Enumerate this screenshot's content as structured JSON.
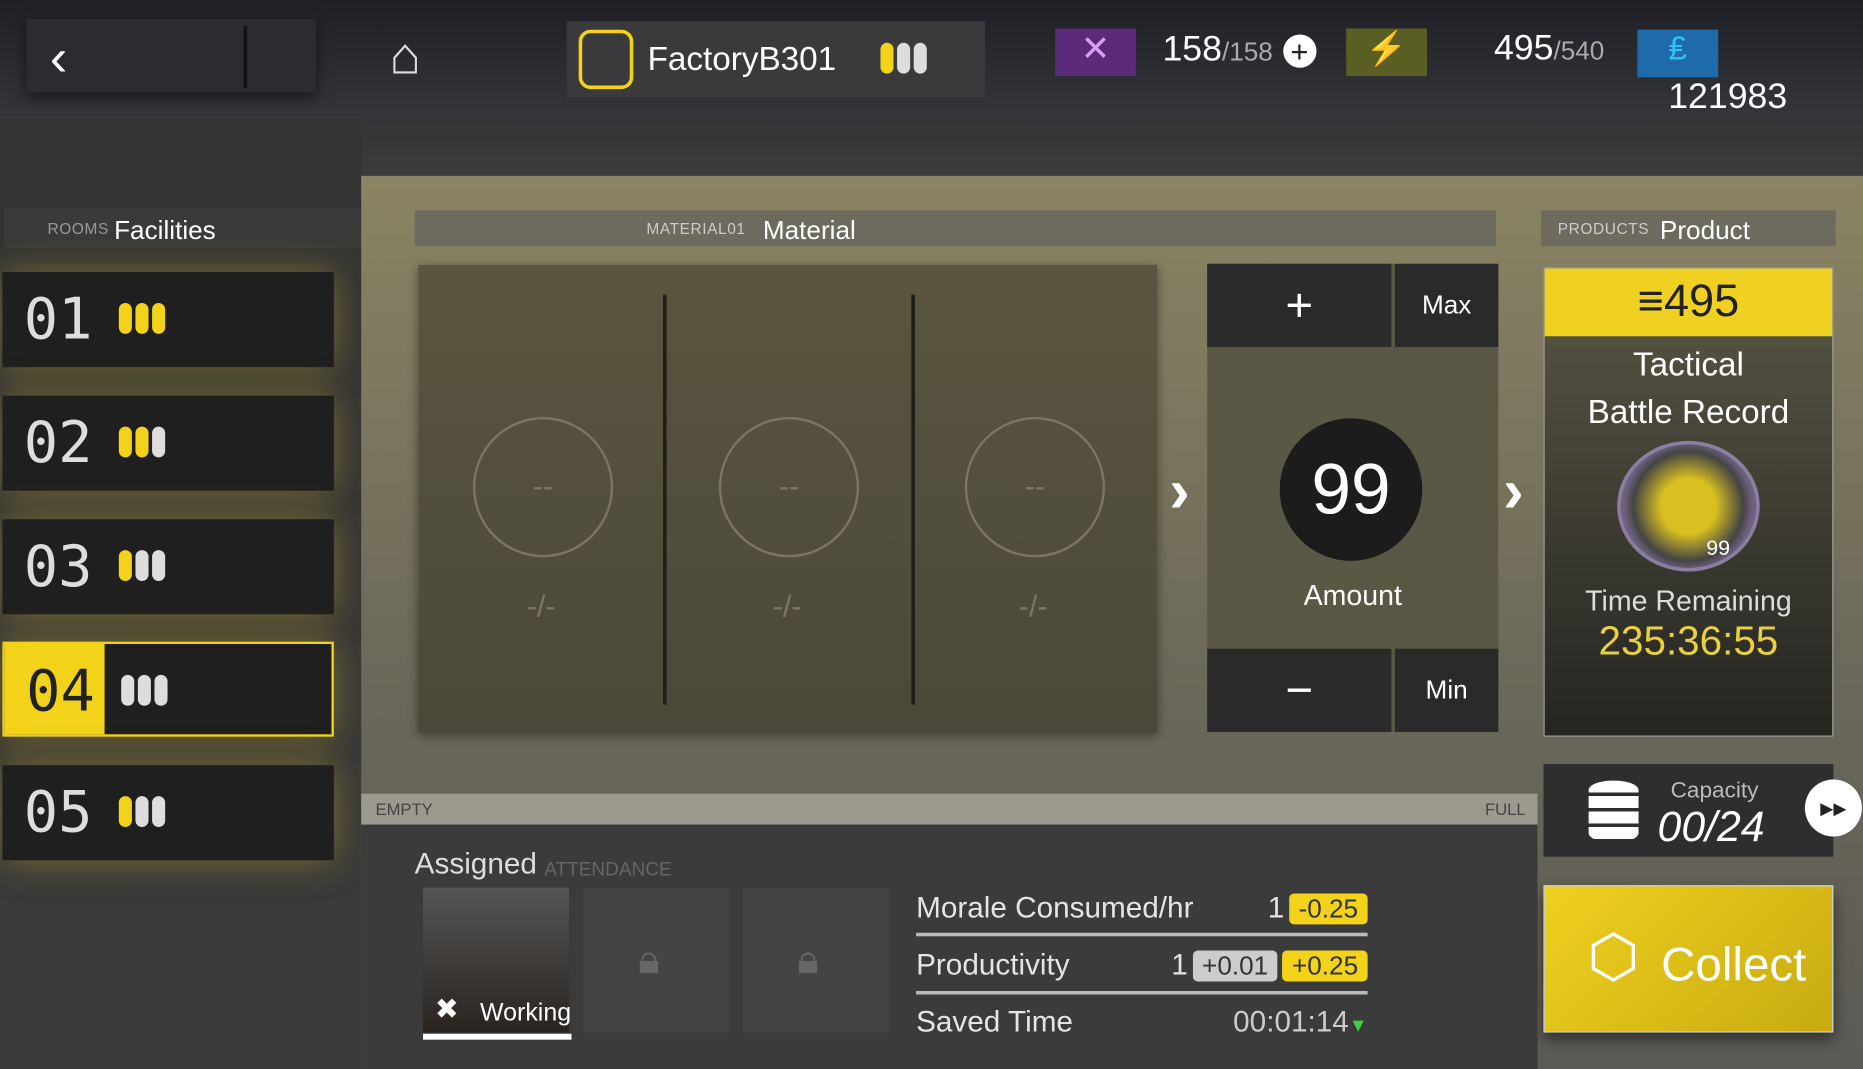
{
  "header": {
    "facility_name": "FactoryB301",
    "resources": [
      {
        "icon": "drone-icon",
        "color": "#8a3fa8",
        "value": "158",
        "max": "/158"
      },
      {
        "icon": "battery-icon",
        "color": "#b8d428",
        "value": "495",
        "max": "/540"
      },
      {
        "icon": "ticket-icon",
        "color": "#1aa8e8",
        "value": "121983"
      }
    ]
  },
  "rooms": {
    "label_small": "ROOMS",
    "label": "Facilities",
    "items": [
      "01",
      "02",
      "03",
      "04",
      "05"
    ],
    "selected": "04"
  },
  "material": {
    "label_small": "MATERIAL01",
    "label": "Material",
    "slots": [
      {
        "value": "--",
        "fraction": "-/-"
      },
      {
        "value": "--",
        "fraction": "-/-"
      },
      {
        "value": "--",
        "fraction": "-/-"
      }
    ]
  },
  "amount": {
    "plus": "+",
    "max": "Max",
    "value": "99",
    "label": "Amount",
    "minus": "−",
    "min": "Min"
  },
  "product": {
    "label_small": "PRODUCTS",
    "label": "Product",
    "count": "495",
    "name": "Tactical Battle Record",
    "badge": "99",
    "time_label": "Time Remaining",
    "time": "235:36:55"
  },
  "capacity": {
    "label": "Capacity",
    "value": "00/24"
  },
  "collect": "Collect",
  "bar": {
    "empty": "EMPTY",
    "full": "FULL"
  },
  "assigned": {
    "label": "Assigned",
    "label_small": "ATTENDANCE",
    "status": "Working"
  },
  "stats": {
    "morale_label": "Morale Consumed/hr",
    "morale_base": "1",
    "morale_chip": "-0.25",
    "prod_label": "Productivity",
    "prod_base": "1",
    "prod_chip1": "+0.01",
    "prod_chip2": "+0.25",
    "saved_label": "Saved Time",
    "saved_value": "00:01:14"
  },
  "colors": {
    "accent": "#f3d31a"
  }
}
